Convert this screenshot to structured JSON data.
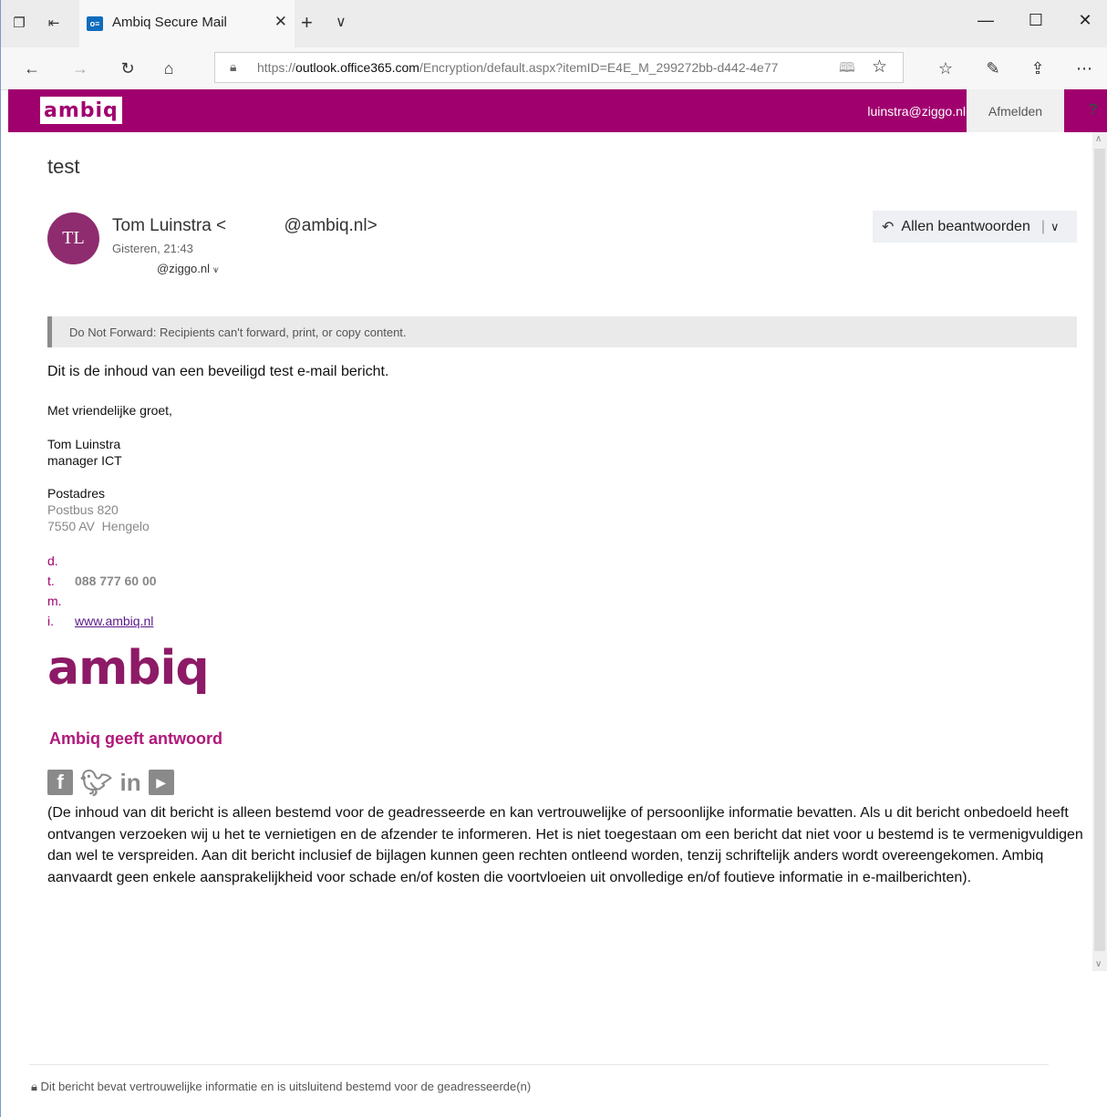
{
  "browser": {
    "tab_title": "Ambiq Secure Mail",
    "tab_favicon_text": "o≡",
    "url_prefix": "https://",
    "url_domain": "outlook.office365.com",
    "url_path": "/Encryption/default.aspx?itemID=E4E_M_299272bb-d442-4e77",
    "icons": [
      "tab-actions-icon",
      "tab-back-icon",
      "close-tab-icon",
      "new-tab-icon",
      "tab-dropdown-icon",
      "minimize-icon",
      "maximize-icon",
      "close-window-icon",
      "back-icon",
      "forward-icon",
      "refresh-icon",
      "home-icon",
      "lock-icon",
      "reading-view-icon",
      "favorite-star-icon",
      "favorites-hub-icon",
      "pen-icon",
      "share-icon",
      "more-icon"
    ]
  },
  "header": {
    "logo": "ambiq",
    "user": "luinstra@ziggo.nl",
    "signout": "Afmelden",
    "help": "?",
    "brand_color": "#a0006e"
  },
  "message": {
    "subject": "test",
    "avatar_initials": "TL",
    "from": "Tom Luinstra <            @ambiq.nl>",
    "date": "Gisteren, 21:43",
    "to": "@ziggo.nl",
    "reply_all": "Allen beantwoorden",
    "do_not_forward": "Do Not Forward: Recipients can't forward, print, or copy content.",
    "body": "Dit is de inhoud van een beveiligd test e-mail bericht."
  },
  "signature": {
    "greeting": "Met vriendelijke groet,",
    "name": "Tom Luinstra",
    "role": "manager ICT",
    "address_label": "Postadres",
    "address_line1": "Postbus 820",
    "address_line2": "7550 AV  Hengelo",
    "contacts": [
      {
        "key": "d.",
        "value": ""
      },
      {
        "key": "t.",
        "value": "088 777 60 00"
      },
      {
        "key": "m.",
        "value": ""
      },
      {
        "key": "i.",
        "value": "www.ambiq.nl"
      }
    ],
    "logo": "ambiq",
    "tagline": "Ambiq geeft antwoord",
    "social_icons": [
      "facebook-icon",
      "twitter-icon",
      "linkedin-icon",
      "youtube-icon"
    ],
    "disclaimer": "(De inhoud van dit bericht is alleen bestemd voor de geadresseerde en kan vertrouwelijke of persoonlijke informatie bevatten. Als u dit bericht onbedoeld heeft ontvangen verzoeken wij u het te vernietigen en de afzender te informeren. Het is niet toegestaan om een bericht dat niet voor u bestemd is te vermenigvuldigen dan wel te verspreiden. Aan dit bericht inclusief de bijlagen kunnen geen rechten ontleend worden, tenzij schriftelijk anders wordt overeengekomen. Ambiq aanvaardt geen enkele aansprakelijkheid voor schade en/of kosten die voortvloeien uit onvolledige en/of foutieve informatie in e-mailberichten)."
  },
  "footer": {
    "text": "Dit bericht bevat vertrouwelijke informatie en is uitsluitend bestemd voor de geadresseerde(n)"
  }
}
